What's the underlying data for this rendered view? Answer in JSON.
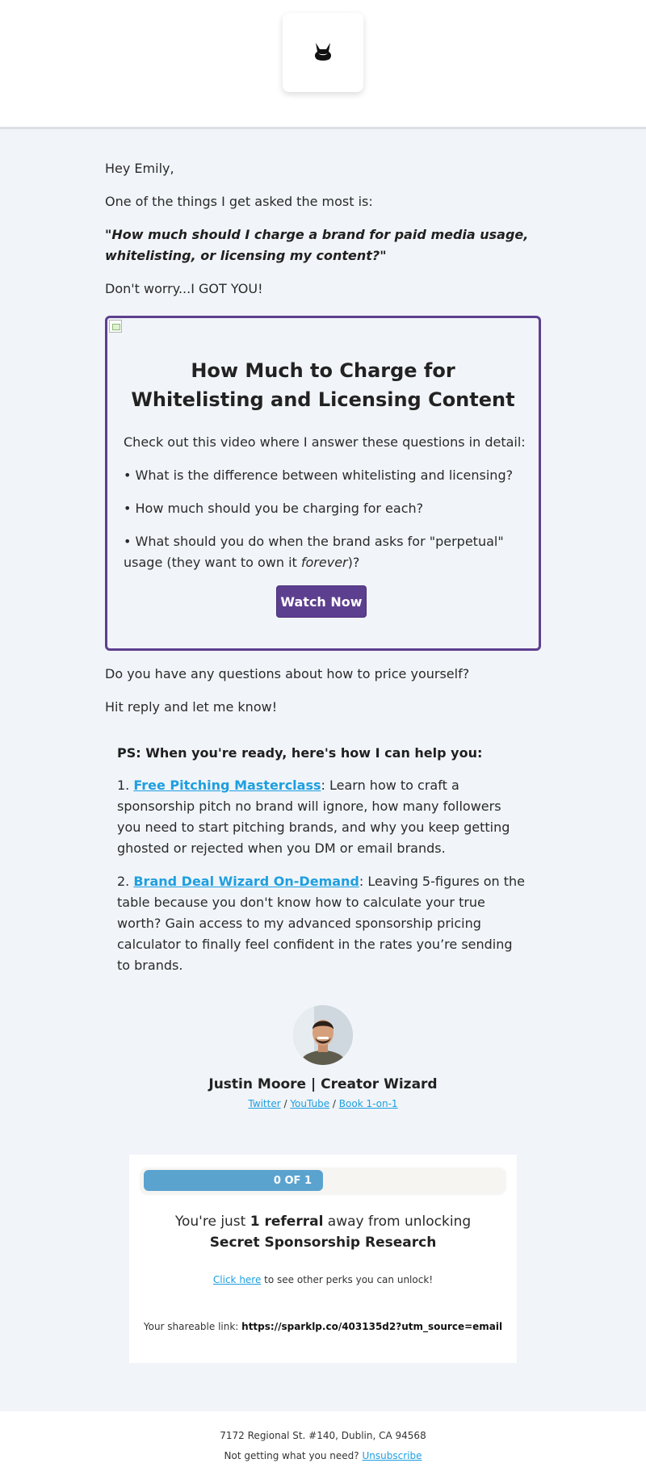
{
  "greeting": "Hey Emily,",
  "intro": "One of the things I get asked the most is:",
  "quote": "\"How much should I charge a brand for paid media usage, whitelisting, or licensing my content?\"",
  "reassure": "Don't worry...I GOT YOU!",
  "card": {
    "title": "How Much to Charge for Whitelisting and Licensing Content",
    "lead": "Check out this video where I answer these questions in detail:",
    "bullet1": "• What is the difference between whitelisting and licensing?",
    "bullet2": "• How much should you be charging for each?",
    "bullet3_before": "• What should you do when the brand asks for \"perpetual\" usage (they want to own it ",
    "bullet3_em": "forever",
    "bullet3_after": ")?",
    "button": "Watch Now"
  },
  "question": "Do you have any questions about how to price yourself?",
  "reply": "Hit reply and let me know!",
  "ps": {
    "heading": "PS: When you're ready, here's how I can help you:",
    "item1_num": "1. ",
    "item1_link": "Free Pitching Masterclass",
    "item1_text": ": Learn how to craft a sponsorship pitch no brand will ignore, how many followers you need to start pitching brands, and why you keep getting ghosted or rejected when you DM or email brands.",
    "item2_num": "2. ",
    "item2_link": "Brand Deal Wizard On-Demand",
    "item2_text": ": Leaving 5-figures on the table because you don't know how to calculate your true worth? Gain access to my advanced sponsorship pricing calculator to finally feel confident in the rates you’re sending to brands."
  },
  "signature": {
    "name": "Justin Moore | Creator Wizard",
    "link_twitter": "Twitter",
    "link_youtube": "YouTube",
    "link_book": "Book 1-on-1",
    "sep": " / "
  },
  "referral": {
    "progress_label": "0 OF 1",
    "progress_fraction": 0.5,
    "msg_before": "You're just ",
    "msg_count": "1 referral",
    "msg_mid": " away from unlocking ",
    "msg_reward": "Secret Sponsorship Research",
    "perks_link": "Click here",
    "perks_text": " to see other perks you can unlock!",
    "share_label": "Your shareable link: ",
    "share_url": "https://sparklp.co/403135d2?utm_source=email"
  },
  "footer": {
    "address": "7172 Regional St. #140, Dublin, CA 94568",
    "unsub_text": "Not getting what you need? ",
    "unsub_link": "Unsubscribe"
  },
  "colors": {
    "accent": "#5d3f8f",
    "link": "#1d9fe0",
    "progress": "#5ba3cf",
    "background": "#f1f4f8"
  },
  "icons": {
    "logo": "wizard-hat-logo-icon",
    "broken_image": "broken-image-icon"
  }
}
